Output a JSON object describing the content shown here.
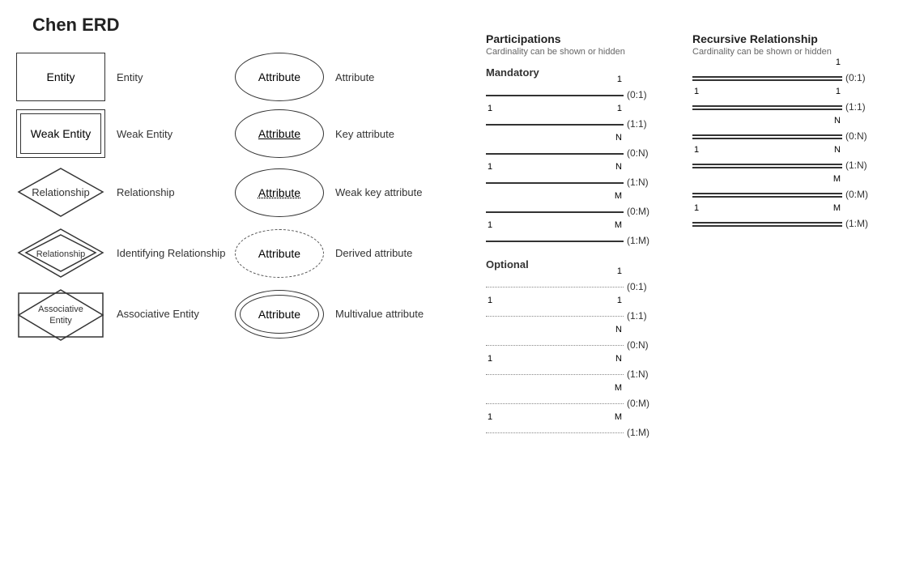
{
  "title": "Chen ERD",
  "shapes": {
    "entities": [
      {
        "name": "Entity",
        "label": "Entity",
        "type": "entity"
      },
      {
        "name": "Weak Entity",
        "label": "Weak Entity",
        "type": "weak-entity"
      },
      {
        "name": "Relationship",
        "label": "Relationship",
        "type": "relationship"
      },
      {
        "name": "Identifying Relationship",
        "label": "Identifying Relationship",
        "type": "identifying-relationship"
      },
      {
        "name": "Associative Entity",
        "label": "Associative Entity",
        "type": "associative-entity"
      }
    ],
    "attributes": [
      {
        "name": "Attribute",
        "label": "Attribute",
        "type": "normal"
      },
      {
        "name": "Attribute",
        "label": "Key attribute",
        "type": "key"
      },
      {
        "name": "Attribute",
        "label": "Weak key attribute",
        "type": "weak-key"
      },
      {
        "name": "Attribute",
        "label": "Derived attribute",
        "type": "derived"
      },
      {
        "name": "Attribute",
        "label": "Multivalue attribute",
        "type": "multivalue"
      }
    ]
  },
  "participations": {
    "title": "Participations",
    "subtitle": "Cardinality can be shown or hidden",
    "mandatory_label": "Mandatory",
    "optional_label": "Optional",
    "mandatory_rows": [
      {
        "left": "",
        "right": "1",
        "cardinality": "(0:1)",
        "line": "single"
      },
      {
        "left": "1",
        "right": "1",
        "cardinality": "(1:1)",
        "line": "single"
      },
      {
        "left": "",
        "right": "N",
        "cardinality": "(0:N)",
        "line": "single"
      },
      {
        "left": "1",
        "right": "N",
        "cardinality": "(1:N)",
        "line": "single"
      },
      {
        "left": "",
        "right": "M",
        "cardinality": "(0:M)",
        "line": "single"
      },
      {
        "left": "1",
        "right": "M",
        "cardinality": "(1:M)",
        "line": "single"
      }
    ],
    "optional_rows": [
      {
        "left": "",
        "right": "1",
        "cardinality": "(0:1)",
        "line": "dotted"
      },
      {
        "left": "1",
        "right": "1",
        "cardinality": "(1:1)",
        "line": "dotted"
      },
      {
        "left": "",
        "right": "N",
        "cardinality": "(0:N)",
        "line": "dotted"
      },
      {
        "left": "1",
        "right": "N",
        "cardinality": "(1:N)",
        "line": "dotted"
      },
      {
        "left": "",
        "right": "M",
        "cardinality": "(0:M)",
        "line": "dotted"
      },
      {
        "left": "1",
        "right": "M",
        "cardinality": "(1:M)",
        "line": "dotted"
      }
    ]
  },
  "recursive": {
    "title": "Recursive Relationship",
    "subtitle": "Cardinality can be shown or hidden",
    "rows": [
      {
        "left": "",
        "right": "1",
        "cardinality": "(0:1)",
        "line": "double"
      },
      {
        "left": "1",
        "right": "1",
        "cardinality": "(1:1)",
        "line": "double"
      },
      {
        "left": "",
        "right": "N",
        "cardinality": "(0:N)",
        "line": "double"
      },
      {
        "left": "1",
        "right": "N",
        "cardinality": "(1:N)",
        "line": "double"
      },
      {
        "left": "",
        "right": "M",
        "cardinality": "(0:M)",
        "line": "double"
      },
      {
        "left": "1",
        "right": "M",
        "cardinality": "(1:M)",
        "line": "double"
      }
    ]
  }
}
